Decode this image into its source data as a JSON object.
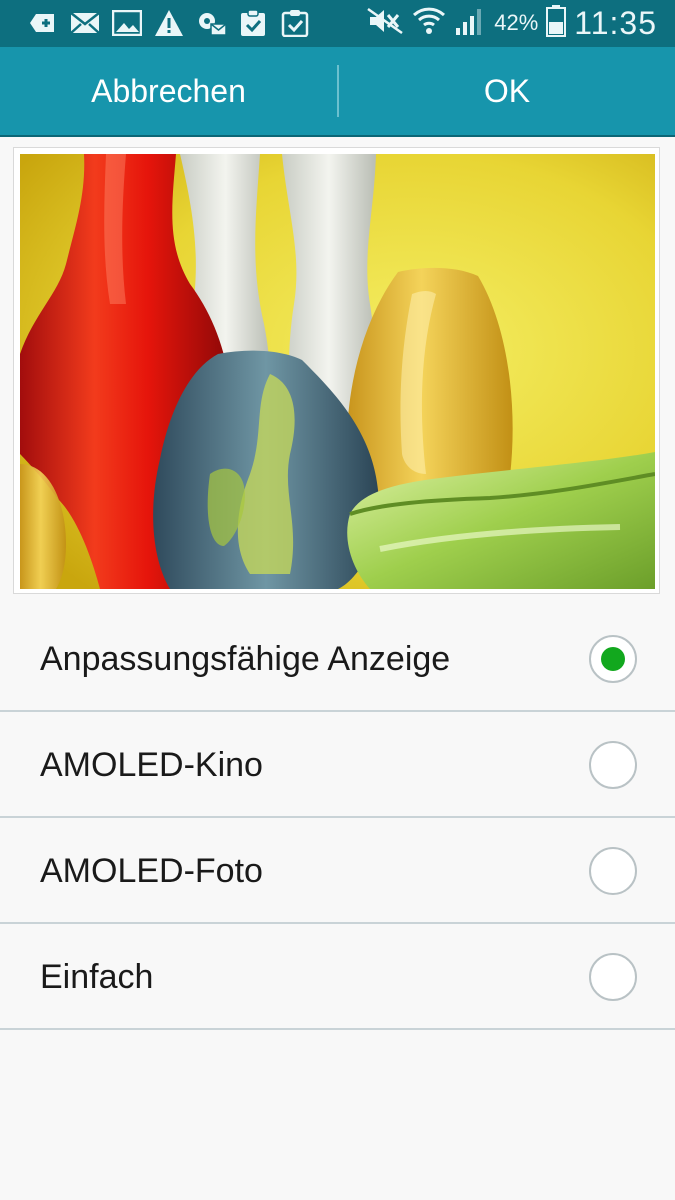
{
  "status_bar": {
    "icons_left": [
      "plus-box-icon",
      "mail-icon",
      "image-icon",
      "warning-icon",
      "gear-mail-icon",
      "clipboard-check-icon",
      "clipboard-check-icon"
    ],
    "battery_percent": "42%",
    "time": "11:35",
    "icons_right": [
      "mute-icon",
      "wifi-icon",
      "signal-icon",
      "battery-icon"
    ]
  },
  "action_bar": {
    "cancel_label": "Abbrechen",
    "ok_label": "OK"
  },
  "preview": {
    "description_icon": "glass-vases-image"
  },
  "options": [
    {
      "label": "Anpassungsfähige Anzeige",
      "selected": true
    },
    {
      "label": "AMOLED-Kino",
      "selected": false
    },
    {
      "label": "AMOLED-Foto",
      "selected": false
    },
    {
      "label": "Einfach",
      "selected": false
    }
  ],
  "colors": {
    "status_bar": "#0d6f7f",
    "action_bar": "#1795ac",
    "radio_selected": "#12a81e"
  }
}
